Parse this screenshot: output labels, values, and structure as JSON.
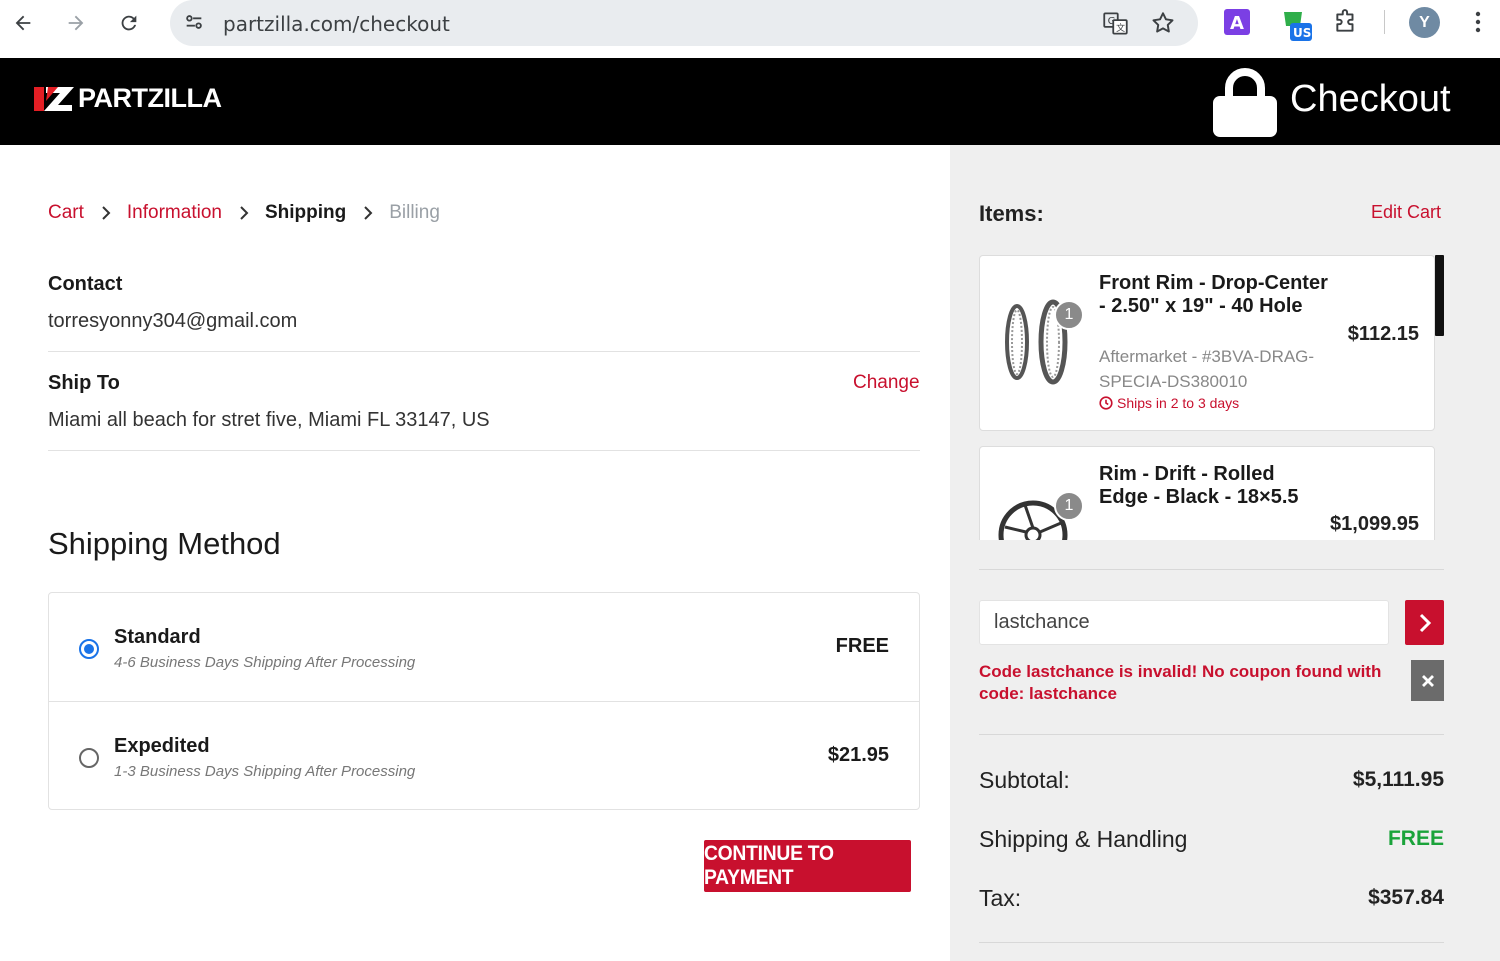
{
  "browser": {
    "url": "partzilla.com/checkout",
    "avatar_initial": "Y",
    "ext_a_label": "A",
    "ext_vpn_label": "US"
  },
  "header": {
    "logo_text": "PARTZILLA",
    "title": "Checkout"
  },
  "breadcrumb": {
    "cart": "Cart",
    "information": "Information",
    "shipping": "Shipping",
    "billing": "Billing"
  },
  "contact": {
    "label": "Contact",
    "value": "torresyonny304@gmail.com"
  },
  "ship_to": {
    "label": "Ship To",
    "change": "Change",
    "value": "Miami all beach for stret five, Miami FL 33147, US"
  },
  "shipping_method": {
    "title": "Shipping Method",
    "options": [
      {
        "name": "Standard",
        "desc": "4-6 Business Days Shipping After Processing",
        "price": "FREE",
        "selected": true
      },
      {
        "name": "Expedited",
        "desc": "1-3 Business Days Shipping After Processing",
        "price": "$21.95",
        "selected": false
      }
    ],
    "continue_label": "CONTINUE TO PAYMENT"
  },
  "summary": {
    "items_label": "Items:",
    "edit_cart": "Edit Cart",
    "items": [
      {
        "name": "Front Rim - Drop-Center - 2.50\" x 19\" - 40 Hole",
        "sku": "Aftermarket - #3BVA-DRAG-SPECIA-DS380010",
        "ships": "Ships in 2 to 3 days",
        "price": "$112.15",
        "qty": "1"
      },
      {
        "name": "Rim - Drift - Rolled Edge - Black - 18×5.5",
        "price": "$1,099.95",
        "qty": "1"
      }
    ],
    "coupon_value": "lastchance",
    "coupon_error": "Code lastchance is invalid! No coupon found with code: lastchance",
    "subtotal_label": "Subtotal:",
    "subtotal": "$5,111.95",
    "shipping_label": "Shipping & Handling",
    "shipping": "FREE",
    "tax_label": "Tax:",
    "tax": "$357.84"
  },
  "colors": {
    "brand_red": "#c8102e",
    "free_green": "#1aa33a",
    "radio_blue": "#1a73e8"
  }
}
